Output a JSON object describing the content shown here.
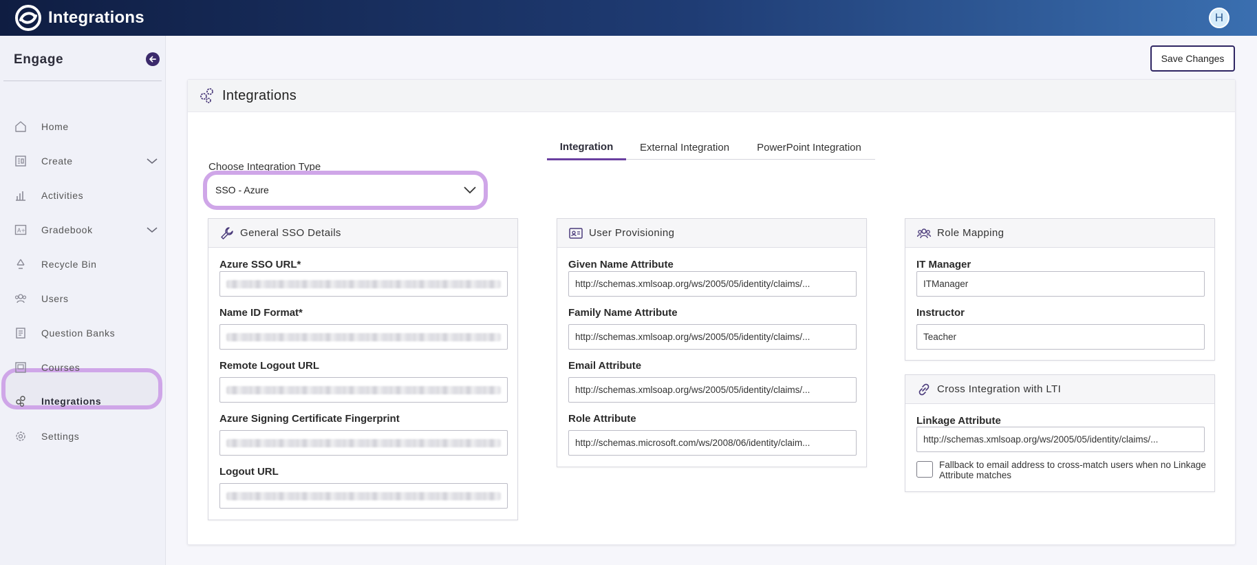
{
  "app": {
    "title": "Integrations",
    "avatar_initial": "H"
  },
  "sidebar": {
    "heading": "Engage",
    "items": [
      {
        "label": "Home",
        "icon": "home-icon"
      },
      {
        "label": "Create",
        "icon": "create-icon",
        "expandable": true
      },
      {
        "label": "Activities",
        "icon": "bar-chart-icon"
      },
      {
        "label": "Gradebook",
        "icon": "gradebook-icon",
        "expandable": true
      },
      {
        "label": "Recycle Bin",
        "icon": "recycle-icon"
      },
      {
        "label": "Users",
        "icon": "users-icon"
      },
      {
        "label": "Question Banks",
        "icon": "question-bank-icon"
      },
      {
        "label": "Courses",
        "icon": "courses-icon"
      },
      {
        "label": "Integrations",
        "icon": "integrations-icon",
        "active": true
      },
      {
        "label": "Settings",
        "icon": "settings-icon"
      }
    ]
  },
  "toolbar": {
    "save_label": "Save Changes"
  },
  "card": {
    "title": "Integrations"
  },
  "tabs": [
    {
      "label": "Integration",
      "active": true
    },
    {
      "label": "External Integration",
      "active": false
    },
    {
      "label": "PowerPoint Integration",
      "active": false
    }
  ],
  "integration_type": {
    "label": "Choose Integration Type",
    "selected": "SSO - Azure"
  },
  "panels": {
    "general_sso": {
      "title": "General SSO Details",
      "fields": [
        {
          "label": "Azure SSO URL*",
          "value": "",
          "redacted": true
        },
        {
          "label": "Name ID Format*",
          "value": "",
          "redacted": true
        },
        {
          "label": "Remote Logout URL",
          "value": "",
          "redacted": true
        },
        {
          "label": "Azure Signing Certificate Fingerprint",
          "value": "",
          "redacted": true
        },
        {
          "label": "Logout URL",
          "value": "",
          "redacted": true
        }
      ]
    },
    "user_provisioning": {
      "title": "User Provisioning",
      "fields": [
        {
          "label": "Given Name Attribute",
          "value": "http://schemas.xmlsoap.org/ws/2005/05/identity/claims/..."
        },
        {
          "label": "Family Name Attribute",
          "value": "http://schemas.xmlsoap.org/ws/2005/05/identity/claims/..."
        },
        {
          "label": "Email Attribute",
          "value": "http://schemas.xmlsoap.org/ws/2005/05/identity/claims/..."
        },
        {
          "label": "Role Attribute",
          "value": "http://schemas.microsoft.com/ws/2008/06/identity/claim..."
        }
      ]
    },
    "role_mapping": {
      "title": "Role Mapping",
      "fields": [
        {
          "label": "IT Manager",
          "value": "ITManager"
        },
        {
          "label": "Instructor",
          "value": "Teacher"
        }
      ]
    },
    "cross_integration": {
      "title": "Cross Integration with LTI",
      "linkage_label": "Linkage Attribute",
      "linkage_value": "http://schemas.xmlsoap.org/ws/2005/05/identity/claims/...",
      "fallback_label": "Fallback to email address to cross-match users when no Linkage Attribute matches",
      "fallback_checked": false
    }
  },
  "colors": {
    "accent": "#6a3fa0",
    "highlight_ring": "#cfa6e8",
    "topbar_start": "#0f1d42",
    "topbar_end": "#3a6fb0"
  }
}
